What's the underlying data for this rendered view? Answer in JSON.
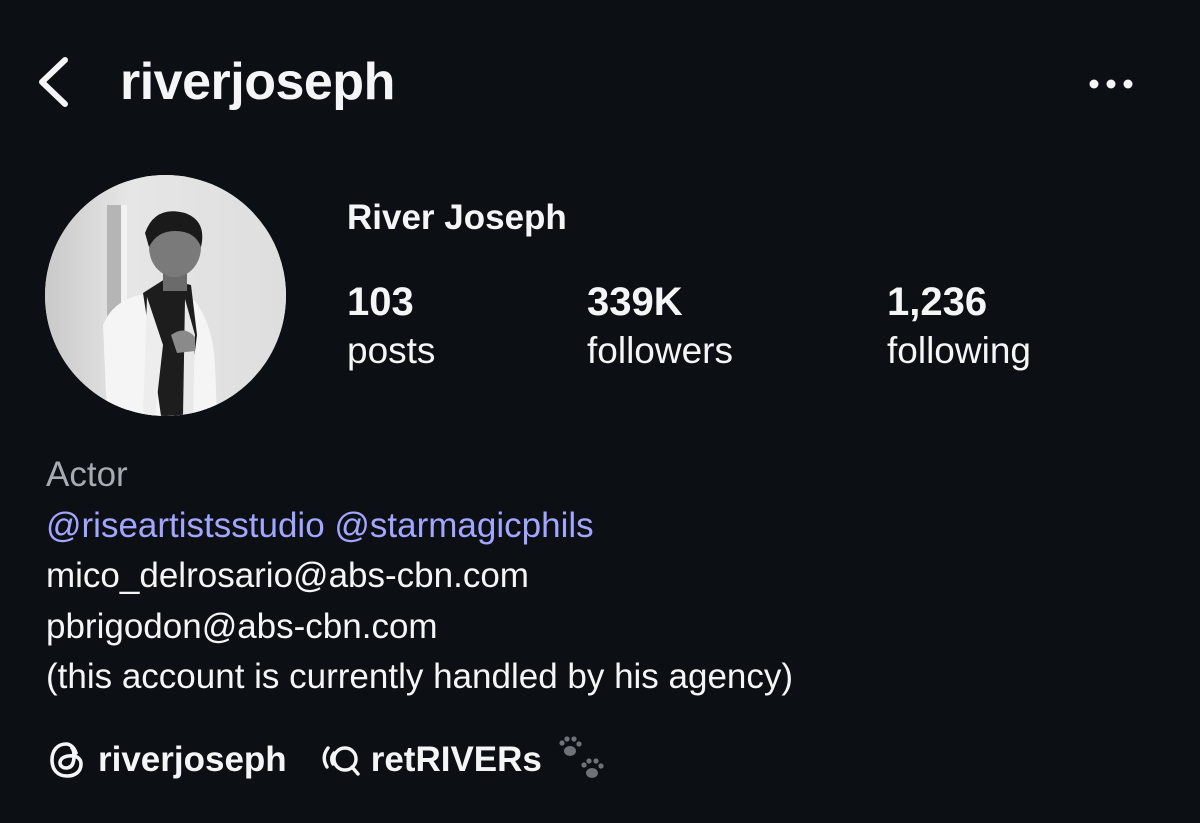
{
  "header": {
    "username": "riverjoseph",
    "back_icon": "chevron-left-icon",
    "more_icon": "ellipsis-icon"
  },
  "profile": {
    "display_name": "River Joseph",
    "avatar": "profile-photo"
  },
  "stats": {
    "posts": {
      "value": "103",
      "label": "posts"
    },
    "followers": {
      "value": "339K",
      "label": "followers"
    },
    "following": {
      "value": "1,236",
      "label": "following"
    }
  },
  "bio": {
    "category": "Actor",
    "mentions": [
      "@riseartistsstudio",
      "@starmagicphils"
    ],
    "email_1": "mico_delrosario@abs-cbn.com",
    "email_2": "pbrigodon@abs-cbn.com",
    "note": "(this account is currently handled by his agency)"
  },
  "links": {
    "threads": {
      "icon": "threads-icon",
      "label": "riverjoseph"
    },
    "channel": {
      "icon": "broadcast-channel-icon",
      "label": "retRIVERs",
      "emoji": "paw-prints-icon"
    }
  },
  "colors": {
    "background": "#0c0f14",
    "text": "#f4f5f7",
    "muted": "#a8abb2",
    "mention": "#a3a6ff"
  }
}
